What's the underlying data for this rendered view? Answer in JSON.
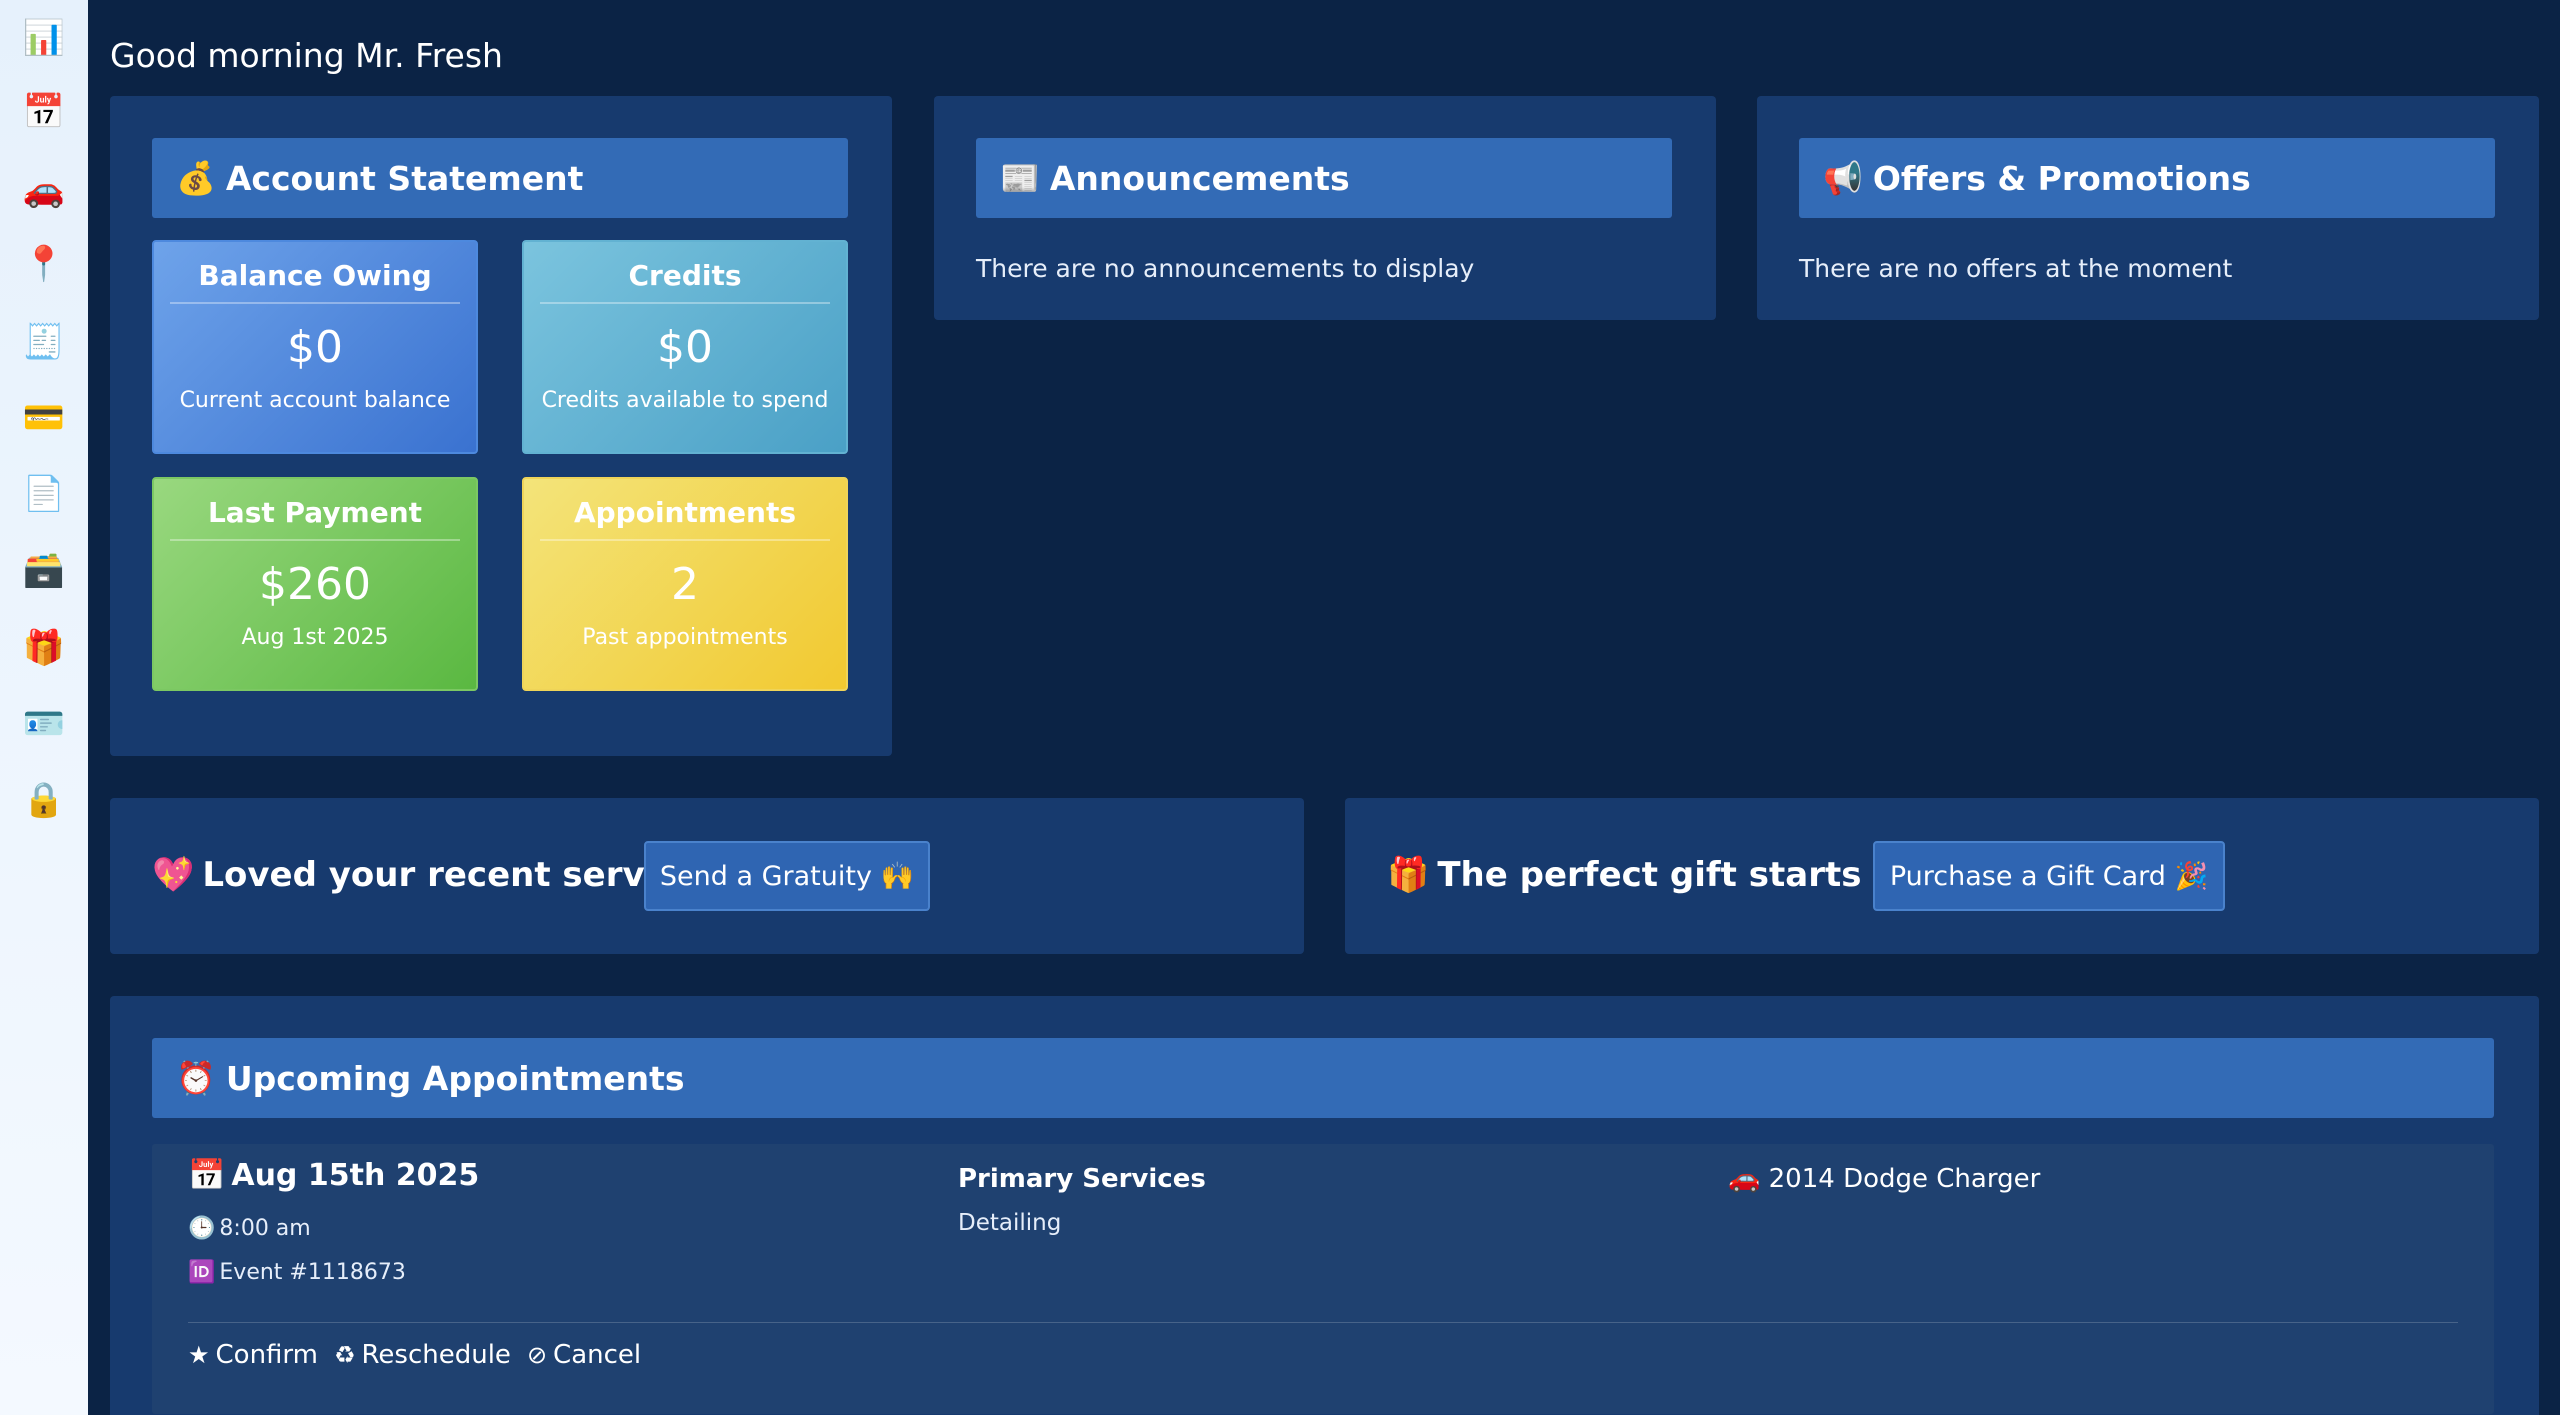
{
  "sidebar": {
    "items": [
      {
        "icon": "bar-chart-icon",
        "glyph": "📊"
      },
      {
        "icon": "calendar-icon",
        "glyph": "📅"
      },
      {
        "icon": "car-icon",
        "glyph": "🚗"
      },
      {
        "icon": "pin-icon",
        "glyph": "📍"
      },
      {
        "icon": "receipt-icon",
        "glyph": "🧾"
      },
      {
        "icon": "credit-card-icon",
        "glyph": "💳"
      },
      {
        "icon": "documents-icon",
        "glyph": "📄"
      },
      {
        "icon": "card-file-box-icon",
        "glyph": "🗃️"
      },
      {
        "icon": "gift-icon",
        "glyph": "🎁"
      },
      {
        "icon": "id-card-icon",
        "glyph": "🪪"
      },
      {
        "icon": "lock-icon",
        "glyph": "🔒"
      }
    ]
  },
  "greeting": "Good morning Mr. Fresh",
  "account": {
    "title_emoji": "💰",
    "title": "Account Statement",
    "cards": [
      {
        "title": "Balance Owing",
        "value": "$0",
        "sub": "Current account balance",
        "color": "#4f87dc"
      },
      {
        "title": "Credits",
        "value": "$0",
        "sub": "Credits available to spend",
        "color": "#5fb0d3"
      },
      {
        "title": "Last Payment",
        "value": "$260",
        "sub": "Aug 1st 2025",
        "color": "#72c458"
      },
      {
        "title": "Appointments",
        "value": "2",
        "sub": "Past appointments",
        "color": "#f1d24a"
      }
    ]
  },
  "announcements": {
    "title_emoji": "📰",
    "title": "Announcements",
    "text": "There are no announcements to display"
  },
  "offers": {
    "title_emoji": "📢",
    "title": "Offers & Promotions",
    "text": "There are no offers at the moment"
  },
  "gratuity": {
    "emoji": "💖",
    "title": "Loved your recent service?",
    "button": "Send a Gratuity 🙌"
  },
  "gift": {
    "emoji": "🎁",
    "title": "The perfect gift starts here",
    "button": "Purchase a Gift Card 🎉"
  },
  "upcoming": {
    "title_emoji": "⏰",
    "title": "Upcoming Appointments",
    "appointment": {
      "date_emoji": "📅",
      "date": "Aug 15th 2025",
      "time_emoji": "🕒",
      "time": "8:00 am",
      "event_emoji": "🆔",
      "event": "Event #1118673",
      "services_label": "Primary Services",
      "service": "Detailing",
      "vehicle_emoji": "🚗",
      "vehicle": "2014 Dodge Charger",
      "actions": {
        "confirm": "Confirm",
        "reschedule": "Reschedule",
        "cancel": "Cancel"
      }
    }
  },
  "colors": {
    "background": "#0b2345",
    "panel": "#173a6e",
    "panel_header": "#336bb6",
    "sidebar": "#e6f1fc"
  }
}
